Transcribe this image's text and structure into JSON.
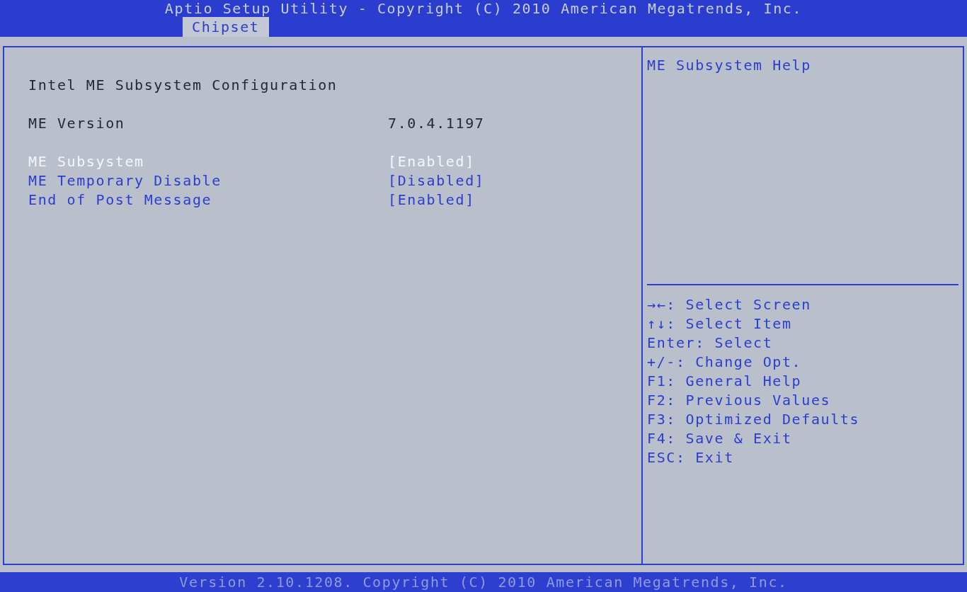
{
  "header": {
    "title": "Aptio Setup Utility - Copyright (C) 2010 American Megatrends, Inc.",
    "tabs": [
      {
        "label": "Chipset",
        "selected": true
      }
    ]
  },
  "main": {
    "heading": "Intel ME Subsystem Configuration",
    "rows": [
      {
        "kind": "info",
        "label": "ME Version",
        "value": "7.0.4.1197"
      },
      {
        "kind": "option",
        "label": "ME Subsystem",
        "value": "[Enabled]",
        "selected": true
      },
      {
        "kind": "option",
        "label": "ME Temporary Disable",
        "value": "[Disabled]",
        "selected": false
      },
      {
        "kind": "option",
        "label": "End of Post Message",
        "value": "[Enabled]",
        "selected": false
      }
    ]
  },
  "help": {
    "text": "ME Subsystem Help",
    "keys": [
      "→←: Select Screen",
      "↑↓: Select Item",
      "Enter: Select",
      "+/-: Change Opt.",
      "F1: General Help",
      "F2: Previous Values",
      "F3: Optimized Defaults",
      "F4: Save & Exit",
      "ESC: Exit"
    ]
  },
  "footer": "Version 2.10.1208. Copyright (C) 2010 American Megatrends, Inc."
}
